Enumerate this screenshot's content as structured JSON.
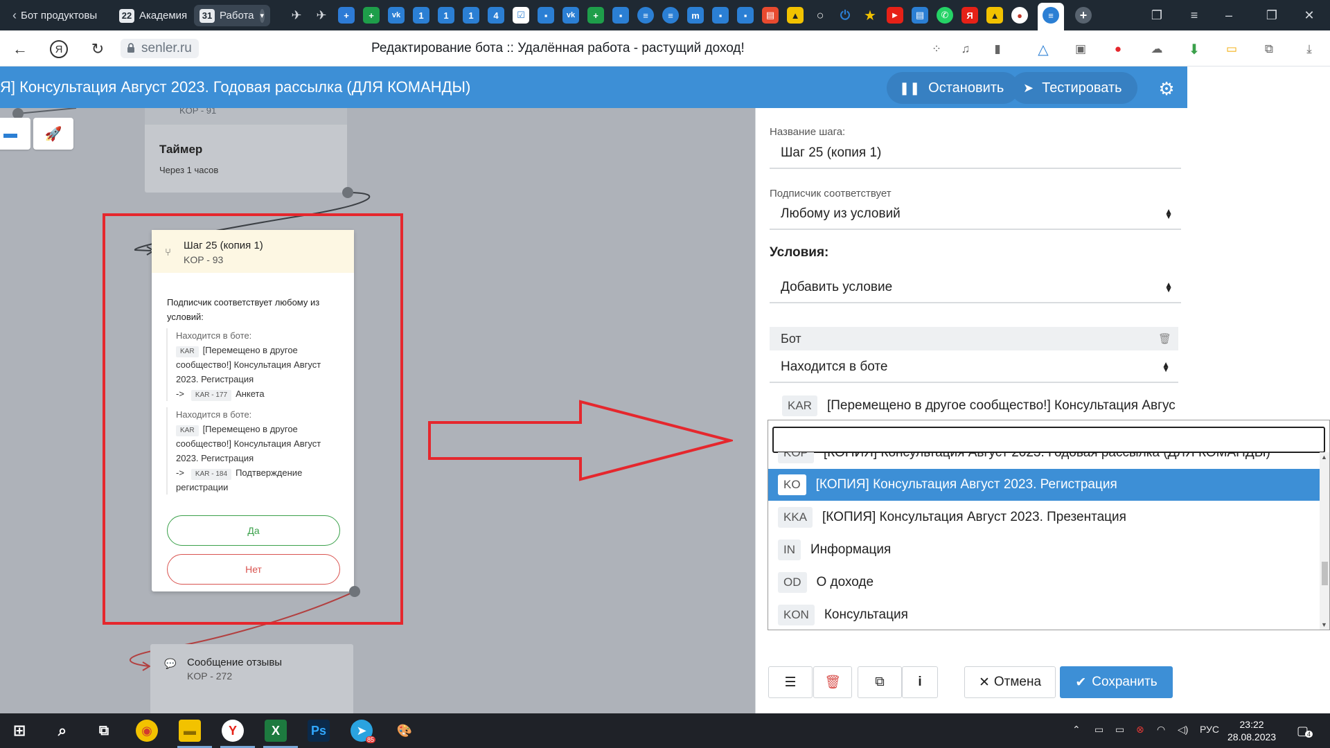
{
  "browser": {
    "tabs": [
      {
        "label": "Бот продуктовы",
        "num": ""
      },
      {
        "label": "Академия",
        "num": "22"
      },
      {
        "label": "Работа",
        "num": "31"
      }
    ],
    "pinned": [
      "1",
      "1",
      "1",
      "4"
    ],
    "url": "senler.ru",
    "page_title": "Редактирование бота :: Удалённая работа - растущий доход!"
  },
  "header": {
    "bot_title": "Я] Консультация Август 2023. Годовая рассылка (ДЛЯ КОМАНДЫ)",
    "stop_label": "Остановить",
    "test_label": "Тестировать"
  },
  "canvas": {
    "timer_node": {
      "code": "KOP - 91",
      "title": "Таймер",
      "subtitle": "Через 1 часов"
    },
    "step_node": {
      "title": "Шаг 25 (копия 1)",
      "code": "KOP - 93",
      "description": "Подписчик соответствует любому из условий:",
      "conditions": [
        {
          "label": "Находится в боте:",
          "tag": "KAR",
          "bot": "[Перемещено в другое сообщество!] Консультация Август 2023. Регистрация",
          "arrow": "->",
          "step_tag": "KAR - 177",
          "step": "Анкета"
        },
        {
          "label": "Находится в боте:",
          "tag": "KAR",
          "bot": "[Перемещено в другое сообщество!] Консультация Август 2023. Регистрация",
          "arrow": "->",
          "step_tag": "KAR - 184",
          "step": "Подтверждение регистрации"
        }
      ],
      "yes_label": "Да",
      "no_label": "Нет"
    },
    "message_node": {
      "title": "Сообщение отзывы",
      "code": "KOP - 272"
    }
  },
  "panel": {
    "step_name_label": "Название шага:",
    "step_name_value": "Шаг 25 (копия 1)",
    "match_label": "Подписчик соответствует",
    "match_value": "Любому из условий",
    "conditions_heading": "Условия:",
    "add_condition": "Добавить условие",
    "bot_row_label": "Бот",
    "in_bot_value": "Находится в боте",
    "selected_bot": {
      "tag": "KAR",
      "name": "[Перемещено в другое сообщество!] Консультация Авгус"
    },
    "dropdown_items": [
      {
        "tag": "KOP",
        "name": "[КОПИЯ] Консультация Август 2023. Годовая рассылка (ДЛЯ КОМАНДЫ)",
        "active": false
      },
      {
        "tag": "KO",
        "name": "[КОПИЯ] Консультация Август 2023. Регистрация",
        "active": true
      },
      {
        "tag": "KKA",
        "name": "[КОПИЯ] Консультация Август 2023. Презентация",
        "active": false
      },
      {
        "tag": "IN",
        "name": "Информация",
        "active": false
      },
      {
        "tag": "OD",
        "name": "О доходе",
        "active": false
      },
      {
        "tag": "KON",
        "name": "Консультация",
        "active": false
      }
    ],
    "cancel_label": "Отмена",
    "save_label": "Сохранить"
  },
  "taskbar": {
    "time": "23:22",
    "date": "28.08.2023",
    "lang": "РУС",
    "telegram_badge": "85",
    "notif_count": "4"
  },
  "colors": {
    "accent": "#3d8fd6",
    "annotation_red": "#e5272d",
    "canvas_bg": "#aeb2b9",
    "yes": "#3aa04a",
    "no": "#d9534f"
  },
  "icons": [
    "back-icon",
    "yandex-icon",
    "reload-icon",
    "lock-icon",
    "pause-icon",
    "send-icon",
    "gear-icon",
    "rocket-icon",
    "chat-icon",
    "trash-icon",
    "menu-icon",
    "copy-icon",
    "info-icon",
    "close-icon",
    "check-icon"
  ]
}
